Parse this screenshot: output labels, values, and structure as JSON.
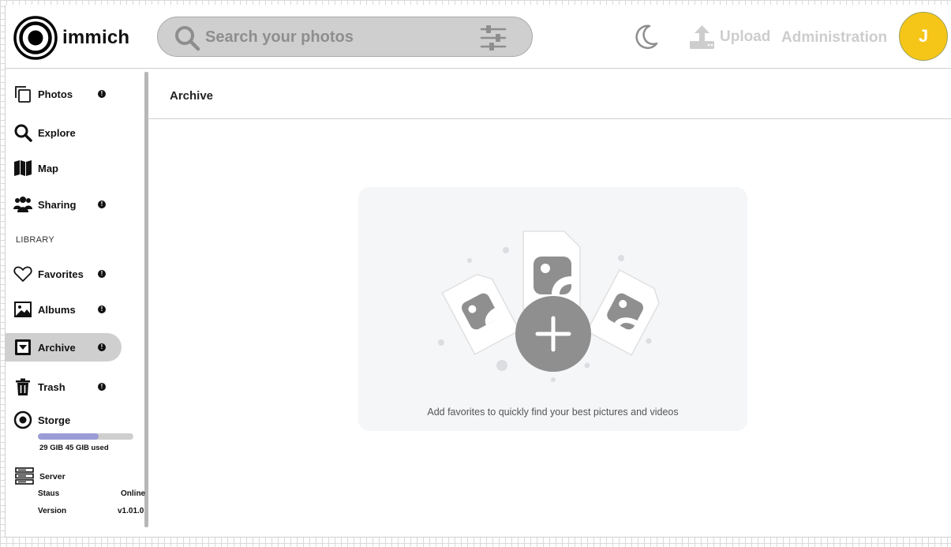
{
  "app": {
    "name": "immich"
  },
  "search": {
    "placeholder": "Search your photos",
    "icon": "search-icon",
    "filter_icon": "sliders-icon"
  },
  "header": {
    "theme_icon": "moon-icon",
    "upload_label": "Upload",
    "upload_icon": "upload-icon",
    "admin_label": "Administration",
    "avatar_initial": "J",
    "avatar_color": "#f5c518"
  },
  "sidebar": {
    "items": [
      {
        "label": "Photos",
        "icon": "photos-icon",
        "badge": true
      },
      {
        "label": "Explore",
        "icon": "search-icon",
        "badge": false
      },
      {
        "label": "Map",
        "icon": "map-icon",
        "badge": false
      },
      {
        "label": "Sharing",
        "icon": "people-icon",
        "badge": true
      }
    ],
    "library_label": "LIBRARY",
    "library_items": [
      {
        "label": "Favorites",
        "icon": "heart-icon",
        "badge": true
      },
      {
        "label": "Albums",
        "icon": "image-icon",
        "badge": true
      },
      {
        "label": "Archive",
        "icon": "archive-icon",
        "badge": true,
        "active": true
      },
      {
        "label": "Trash",
        "icon": "trash-icon",
        "badge": true
      }
    ],
    "storage": {
      "label": "Storge",
      "usage_text": "29 GIB 45 GIB used",
      "used_fraction": 0.64,
      "bar_color": "#9b9cd6"
    },
    "server": {
      "label": "Server",
      "status_label": "Staus",
      "status_value": "Online",
      "version_label": "Version",
      "version_value": "v1.01.0"
    }
  },
  "main": {
    "title": "Archive",
    "empty_message": "Add favorites to quickly find your best pictures and videos"
  }
}
